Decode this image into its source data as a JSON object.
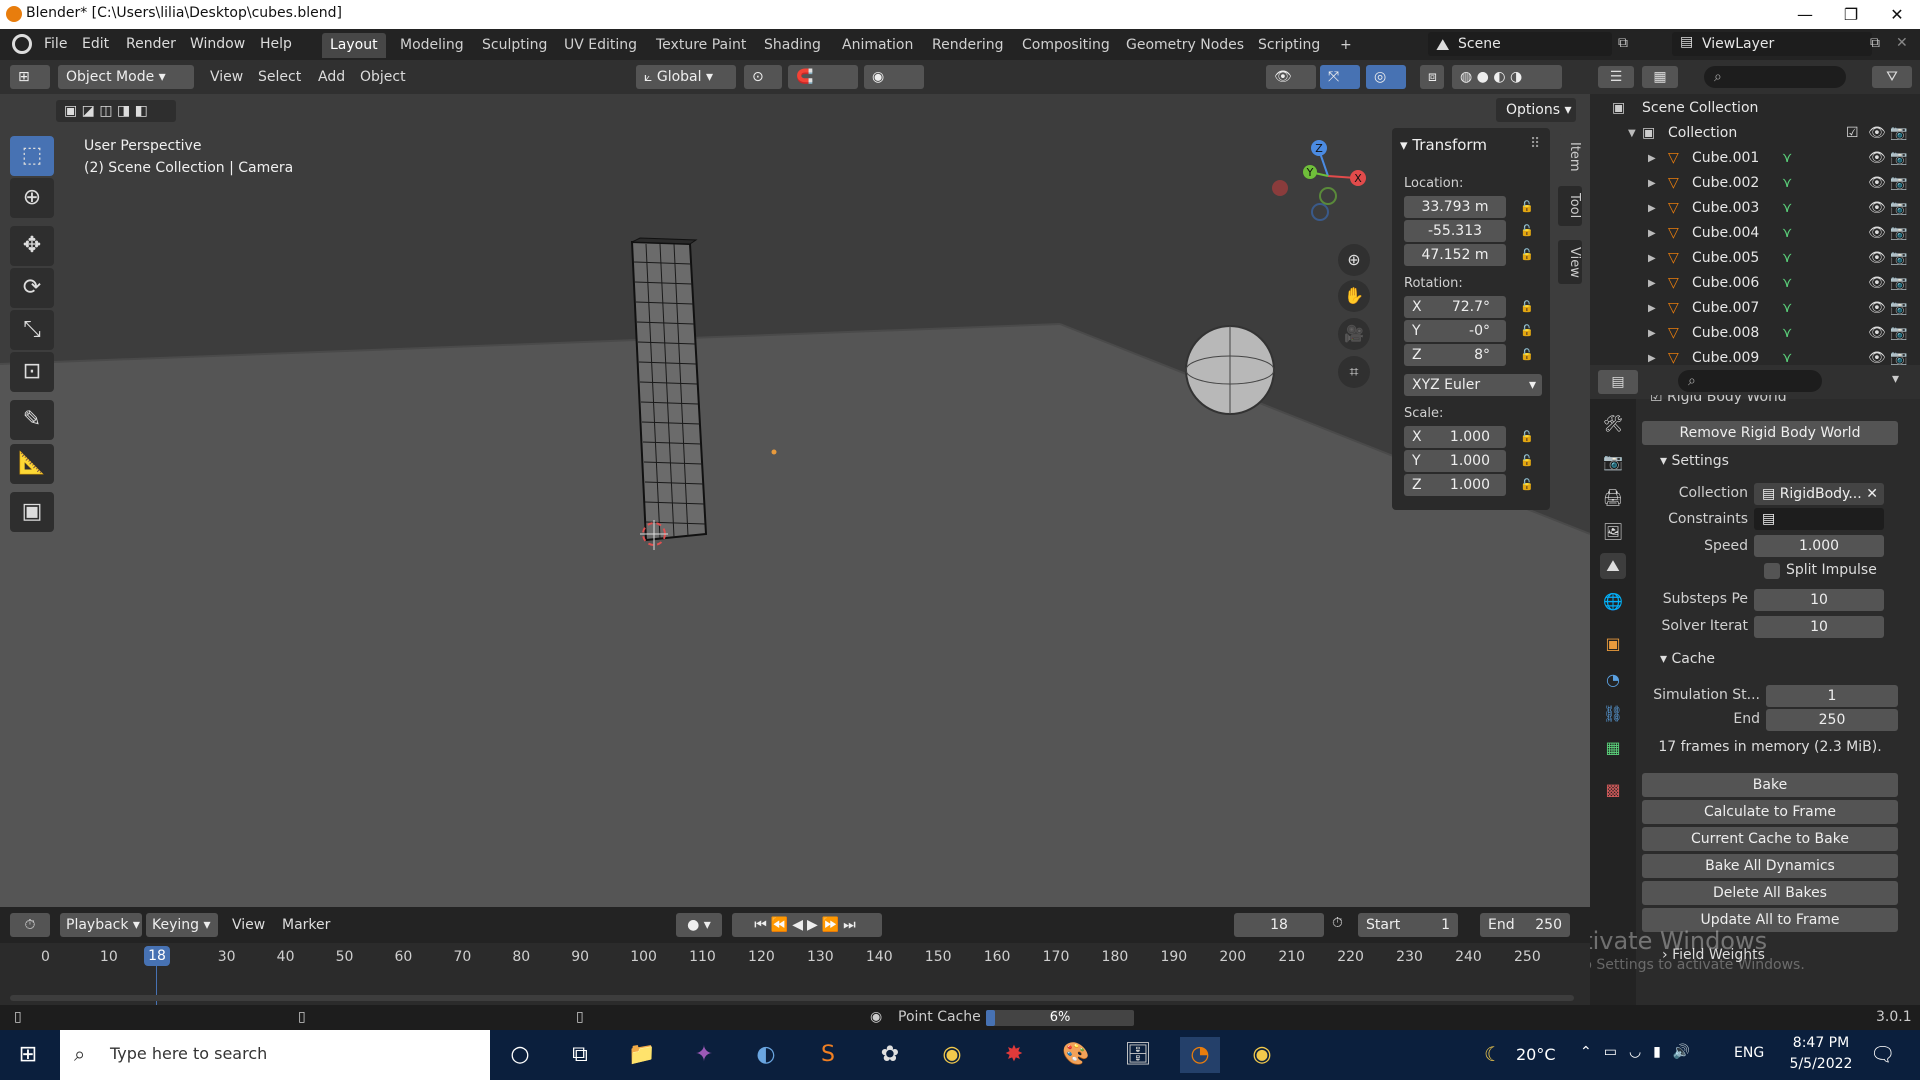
{
  "window": {
    "title": "Blender* [C:\\Users\\lilia\\Desktop\\cubes.blend]",
    "min": "—",
    "max": "❐",
    "close": "✕"
  },
  "menus": [
    "File",
    "Edit",
    "Render",
    "Window",
    "Help"
  ],
  "workspaces": [
    "Layout",
    "Modeling",
    "Sculpting",
    "UV Editing",
    "Texture Paint",
    "Shading",
    "Animation",
    "Rendering",
    "Compositing",
    "Geometry Nodes",
    "Scripting"
  ],
  "workspace_add": "+",
  "scene": {
    "name": "Scene",
    "viewlayer": "ViewLayer"
  },
  "viewport_header": {
    "mode": "Object Mode",
    "menus": [
      "View",
      "Select",
      "Add",
      "Object"
    ],
    "orientation": "Global",
    "options": "Options"
  },
  "viewport": {
    "perspective": "User Perspective",
    "collection_info": "(2) Scene Collection | Camera"
  },
  "gizmo": {
    "x": "X",
    "y": "Y",
    "z": "Z"
  },
  "transform": {
    "title": "Transform",
    "location_label": "Location:",
    "location": [
      "33.793 m",
      "-55.313",
      "47.152 m"
    ],
    "rotation_label": "Rotation:",
    "rotation": [
      {
        "axis": "X",
        "value": "72.7°"
      },
      {
        "axis": "Y",
        "value": "-0°"
      },
      {
        "axis": "Z",
        "value": "8°"
      }
    ],
    "rotation_mode": "XYZ Euler",
    "scale_label": "Scale:",
    "scale": [
      {
        "axis": "X",
        "value": "1.000"
      },
      {
        "axis": "Y",
        "value": "1.000"
      },
      {
        "axis": "Z",
        "value": "1.000"
      }
    ]
  },
  "sidebar_tabs": [
    "Item",
    "Tool",
    "View"
  ],
  "outliner": {
    "root": "Scene Collection",
    "collection": "Collection",
    "items": [
      "Cube.001",
      "Cube.002",
      "Cube.003",
      "Cube.004",
      "Cube.005",
      "Cube.006",
      "Cube.007",
      "Cube.008",
      "Cube.009"
    ]
  },
  "properties": {
    "section_cut": "Rigid Body World",
    "remove_button": "Remove Rigid Body World",
    "settings_title": "Settings",
    "collection_label": "Collection",
    "collection_value": "RigidBody...",
    "constraints_label": "Constraints",
    "speed_label": "Speed",
    "speed_value": "1.000",
    "split_impulse": "Split Impulse",
    "substeps_label": "Substeps Pe",
    "substeps_value": "10",
    "solver_label": "Solver Iterat",
    "solver_value": "10",
    "cache_title": "Cache",
    "sim_start_label": "Simulation St...",
    "sim_start_value": "1",
    "end_label": "End",
    "end_value": "250",
    "memory_info": "17 frames in memory (2.3 MiB).",
    "buttons": [
      "Bake",
      "Calculate to Frame",
      "Current Cache to Bake",
      "Bake All Dynamics",
      "Delete All Bakes",
      "Update All to Frame"
    ],
    "field_weights": "Field Weights"
  },
  "timeline": {
    "menus": [
      "Playback",
      "Keying",
      "View",
      "Marker"
    ],
    "current_frame": "18",
    "start_label": "Start",
    "start_value": "1",
    "end_label": "End",
    "end_value": "250",
    "ticks": [
      "0",
      "10",
      "30",
      "40",
      "50",
      "60",
      "70",
      "80",
      "90",
      "100",
      "110",
      "120",
      "130",
      "140",
      "150",
      "160",
      "170",
      "180",
      "190",
      "200",
      "210",
      "220",
      "230",
      "240",
      "250"
    ],
    "playhead": "18"
  },
  "statusbar": {
    "point_cache": "Point Cache",
    "progress": "6%",
    "progress_fraction": 0.06,
    "version": "3.0.1"
  },
  "watermark": {
    "line1": "Activate Windows",
    "line2": "Go to Settings to activate Windows."
  },
  "taskbar": {
    "search_placeholder": "Type here to search",
    "weather": "20°C",
    "lang": "ENG",
    "time": "8:47 PM",
    "date": "5/5/2022"
  }
}
